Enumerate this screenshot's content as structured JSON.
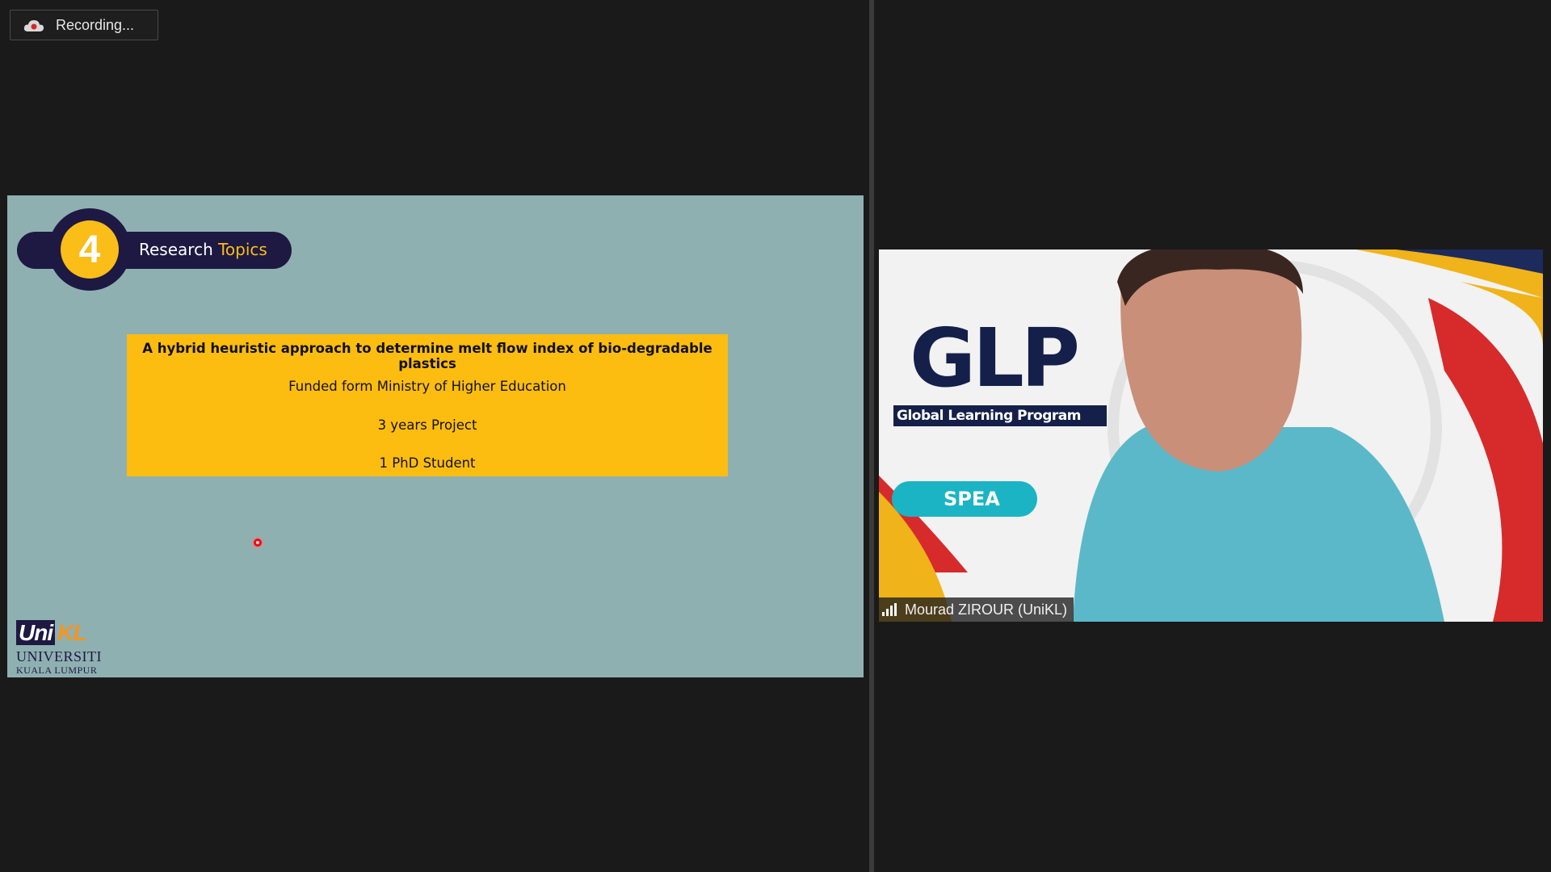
{
  "recording": {
    "label": "Recording..."
  },
  "slide": {
    "badge_number": "4",
    "title_part1": "Research",
    "title_part2": "Topics",
    "topic": {
      "title": "A hybrid heuristic approach to determine melt flow index of bio-degradable plastics",
      "funding": "Funded form Ministry of Higher Education",
      "duration": "3 years Project",
      "students": "1 PhD Student"
    },
    "logo": {
      "mark_uni": "Uni",
      "mark_kl": "KL",
      "line1": "UNIVERSITI",
      "line2": "KUALA LUMPUR"
    }
  },
  "video": {
    "participant_name": "Mourad ZIROUR (UniKL)",
    "background": {
      "glp": "GLP",
      "program": "Global Learning Program",
      "speaker": "SPEA"
    }
  },
  "colors": {
    "slide_bg": "#8fb0b1",
    "navy": "#1d1942",
    "gold": "#fbbd18",
    "topic_box": "#fdbd10",
    "app_bg": "#1a1a1a"
  },
  "icons": [
    "recording-cloud-icon",
    "signal-strength-icon",
    "laser-pointer-icon"
  ]
}
